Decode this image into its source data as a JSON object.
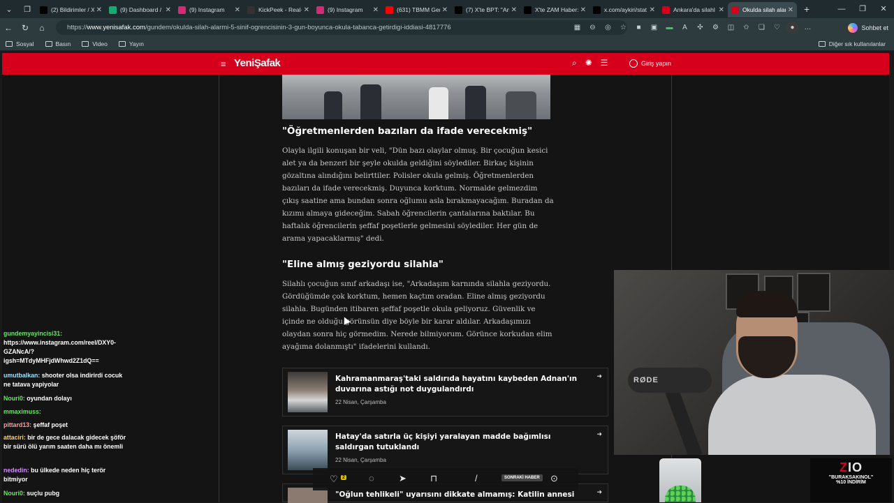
{
  "browser": {
    "tabs": [
      {
        "title": "(2) Bildirimler / X",
        "icon": "x-icon",
        "color": "#000000"
      },
      {
        "title": "(9) Dashboard / X",
        "icon": "dashboard-icon",
        "color": "#19a974"
      },
      {
        "title": "(9) Instagram",
        "icon": "instagram-icon",
        "color": "#d62976"
      },
      {
        "title": "KickPeek - Real-ti",
        "icon": "kickpeek-icon",
        "color": "#333333"
      },
      {
        "title": "(9) Instagram",
        "icon": "instagram-icon",
        "color": "#d62976"
      },
      {
        "title": "(631) TBMM Gen",
        "icon": "youtube-icon",
        "color": "#ff0000"
      },
      {
        "title": "(7) X'te BPT: \"Ank",
        "icon": "x-icon",
        "color": "#000000"
      },
      {
        "title": "X'te ZAM Haber:",
        "icon": "x-icon",
        "color": "#000000"
      },
      {
        "title": "x.com/aykiri/stat",
        "icon": "x-icon",
        "color": "#000000"
      },
      {
        "title": "Ankara'da silahl",
        "icon": "news-icon",
        "color": "#d6001c"
      },
      {
        "title": "Okulda silah alar",
        "icon": "yenisafak-icon",
        "color": "#d6001c"
      }
    ],
    "active_tab": 10,
    "new_tab_label": "+",
    "url_prefix": "https://",
    "url_domain": "www.yenisafak.com",
    "url_path": "/gundem/okulda-silah-alarmi-5-sinif-ogrencisinin-3-gun-boyunca-okula-tabanca-getirdigi-iddiasi-4817776",
    "chat_label": "Sohbet et",
    "bookmarks": [
      {
        "label": "Sosyal"
      },
      {
        "label": "Basın"
      },
      {
        "label": "Video"
      },
      {
        "label": "Yayın"
      }
    ],
    "other_bookmarks": "Diğer sık kullanılanlar"
  },
  "site": {
    "logo": "YeniŞafak",
    "login_label": "Giriş yapın",
    "brand_color": "#d6001c"
  },
  "article": {
    "heading1": "\"Öğretmenlerden bazıları da ifade verecekmiş\"",
    "para1": "Olayla ilgili konuşan bir veli, \"Dün bazı olaylar olmuş. Bir çocuğun kesici alet ya da benzeri bir şeyle okulda geldiğini söylediler. Birkaç kişinin gözaltına alındığını belirttiler. Polisler okula gelmiş. Öğretmenlerden bazıları da ifade verecekmiş. Duyunca korktum. Normalde gelmezdim çıkış saatine ama bundan sonra oğlumu asla bırakmayacağım. Buradan da kızımı almaya gideceğim. Sabah öğrencilerin çantalarına baktılar. Bu haftalık öğrencilerin şeffaf poşetlerle gelmesini söylediler. Her gün de arama yapacaklarmış\" dedi.",
    "heading2": "\"Eline almış geziyordu silahla\"",
    "para2": "Silahlı çocuğun sınıf arkadaşı ise, \"Arkadaşım karnında silahla geziyordu. Gördüğümde çok korktum, hemen kaçtım oradan. Eline almış geziyordu silahla. Bugünden itibaren şeffaf poşetle okula geliyoruz. Güvenlik ve içinde ne olduğu görünsün diye böyle bir karar aldılar. Arkadaşımızı olaydan sonra hiç görmedim. Nerede bilmiyorum. Görünce korkudan elim ayağıma dolanmıştı\" ifadelerini kullandı.",
    "related": [
      {
        "title": "Kahramanmaraş'taki saldırıda hayatını kaybeden Adnan'ın duvarına astığı not duygulandırdı",
        "date": "22 Nisan, Çarşamba"
      },
      {
        "title": "Hatay'da satırla üç kişiyi yaralayan madde bağımlısı saldırgan tutuklandı",
        "date": "22 Nisan, Çarşamba"
      },
      {
        "title": "\"Oğlun tehlikeli\" uyarısını dikkate almamış: Katilin annesi",
        "date": ""
      }
    ],
    "action_like_count": "2",
    "next_news_label": "SONRAKİ HABER"
  },
  "chat": [
    {
      "user": "gundemyayincisi31:",
      "msg": "https://www.instagram.com/reel/DXY0-GZANcA/?igsh=MTdyMHFjdWhwd2Z1dQ==",
      "color": "#6ee36e"
    },
    {
      "user": "umutbalkan:",
      "msg": "shooter olsa indirirdi cocuk ne tatava yapiyolar",
      "color": "#9fe0ff"
    },
    {
      "user": "Nouri0:",
      "msg": "oyundan dolayı",
      "color": "#6ee36e"
    },
    {
      "user": "mmaximuss:",
      "msg": "",
      "color": "#6ee36e"
    },
    {
      "user": "pittard13:",
      "msg": "şeffaf poşet",
      "color": "#ff9e9e"
    },
    {
      "user": "attaciri:",
      "msg": "bir de gece dalacak gidecek şöför bir sürü ölü yarım saaten daha mı önemli",
      "color": "#ffd36e"
    },
    {
      "user": "nededin:",
      "msg": "bu ülkede neden hiç terör bitmiyor",
      "color": "#d58cff"
    },
    {
      "user": "Nouri0:",
      "msg": "suçlu pubg",
      "color": "#6ee36e"
    }
  ],
  "stream": {
    "mic_brand": "RØDE",
    "promo_logo_a": "Z",
    "promo_logo_b": "IO",
    "promo_code": "\"BURAKSAKINOL\"",
    "promo_discount": "%10 İNDİRİM"
  }
}
